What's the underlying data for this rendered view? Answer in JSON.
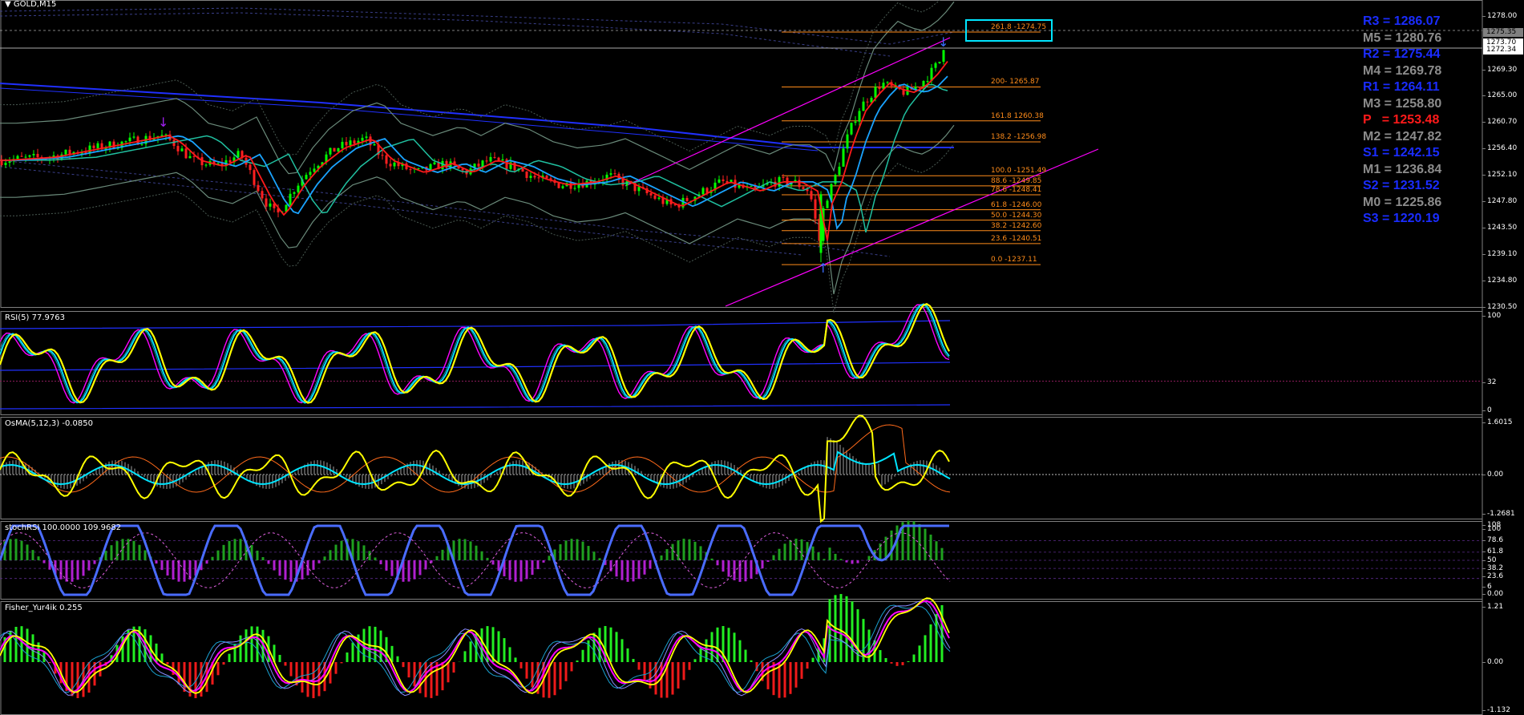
{
  "title": "GOLD,M15",
  "title_marker": "▼",
  "panes": {
    "rsi": "RSI(5) 77.9763",
    "osma": "OsMA(5,12,3) -0.0850",
    "stoch": "stochRSI 100.0000 109.9682",
    "fisher": "Fisher_Yur4ik 0.255"
  },
  "pivots": [
    {
      "text": "R3 = 1286.07",
      "color": "#1a2cff"
    },
    {
      "text": "M5 = 1280.76",
      "color": "#8c8c8c"
    },
    {
      "text": "R2 = 1275.44",
      "color": "#1a2cff"
    },
    {
      "text": "M4 = 1269.78",
      "color": "#8c8c8c"
    },
    {
      "text": "R1 = 1264.11",
      "color": "#1a2cff"
    },
    {
      "text": "M3 = 1258.80",
      "color": "#8c8c8c"
    },
    {
      "text": "P   = 1253.48",
      "color": "#ff1a1a"
    },
    {
      "text": "M2 = 1247.82",
      "color": "#8c8c8c"
    },
    {
      "text": "S1 = 1242.15",
      "color": "#1a2cff"
    },
    {
      "text": "M1 = 1236.84",
      "color": "#8c8c8c"
    },
    {
      "text": "S2 = 1231.52",
      "color": "#1a2cff"
    },
    {
      "text": "M0 = 1225.86",
      "color": "#8c8c8c"
    },
    {
      "text": "S3 = 1220.19",
      "color": "#1a2cff"
    }
  ],
  "fib_levels": [
    {
      "label": "261.8 -1274.75",
      "price": 1274.75
    },
    {
      "label": "200- 1265.87",
      "price": 1265.87
    },
    {
      "label": "161.8 1260.38",
      "price": 1260.38
    },
    {
      "label": "138.2 -1256.98",
      "price": 1256.98
    },
    {
      "label": "100.0 -1251.49",
      "price": 1251.49
    },
    {
      "label": "88.6 -1249.85",
      "price": 1249.85
    },
    {
      "label": "78.6 -1248.41",
      "price": 1248.41
    },
    {
      "label": "61.8 -1246.00",
      "price": 1246.0
    },
    {
      "label": "50.0 -1244.30",
      "price": 1244.3
    },
    {
      "label": "38.2 -1242.60",
      "price": 1242.6
    },
    {
      "label": "23.6 -1240.51",
      "price": 1240.51
    },
    {
      "label": "0.0 -1237.11",
      "price": 1237.11
    }
  ],
  "price_scale": {
    "main": [
      "1278.00",
      "1269.30",
      "1265.00",
      "1260.70",
      "1256.40",
      "1252.10",
      "1247.80",
      "1243.50",
      "1239.10",
      "1234.80",
      "1230.50"
    ],
    "highlights": [
      {
        "text": "1275.35",
        "color": "#808080"
      },
      {
        "text": "1273.70",
        "color": "#ffffff"
      },
      {
        "text": "1272.34",
        "color": "#ffffff"
      }
    ],
    "rsi": [
      "100",
      "32",
      "0"
    ],
    "osma": [
      "1.6015",
      "0.00",
      "-1.2681"
    ],
    "stoch": [
      "108",
      "100",
      "78.6",
      "61.8",
      "50",
      "38.2",
      "23.6",
      "6",
      "0.00"
    ],
    "fisher": [
      "1.21",
      "0.00",
      "-1.132"
    ]
  },
  "colors": {
    "bull_candle": "#00ff00",
    "bear_candle": "#ff2020",
    "ma_fast": "#ff1a1a",
    "ma_mid": "#1aa3ff",
    "ma_slow": "#20c0a0",
    "bands": "#6a8a7a",
    "channel": "#ff00ff",
    "fib": "#ff8c1a",
    "rsi_main": "#ffff00",
    "rsi_sig": "#00e5ff",
    "rsi_mag": "#ff00ff",
    "stoch_main": "#4a6cff",
    "hist_pos": "#1fa01f",
    "hist_neg": "#b020d0",
    "fisher_pos": "#22ee22",
    "fisher_neg": "#ee1a1a",
    "highlight_box": "#00e5ff"
  },
  "icons": [
    "down-arrow-icon",
    "up-arrow-icon"
  ]
}
